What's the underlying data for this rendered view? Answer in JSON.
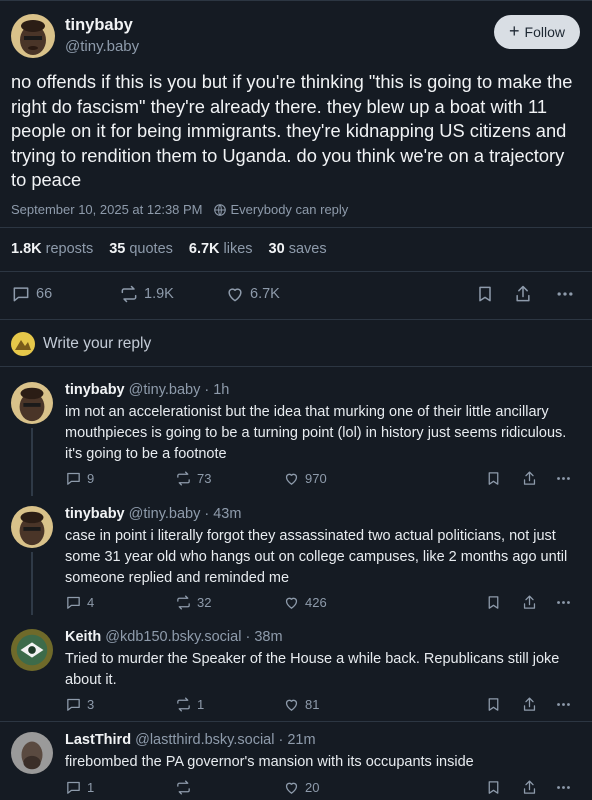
{
  "post": {
    "display_name": "tinybaby",
    "handle": "@tiny.baby",
    "follow_label": "Follow",
    "text": "no offends if this is you but if you're thinking \"this is going to make the right do fascism\" they're already there. they blew up a boat with 11 people on it for being immigrants. they're kidnapping US citizens and trying to rendition them to Uganda. do you think we're on a trajectory to peace",
    "timestamp": "September 10, 2025 at 12:38 PM",
    "reply_setting": "Everybody can reply",
    "stats": [
      {
        "count": "1.8K",
        "label": "reposts"
      },
      {
        "count": "35",
        "label": "quotes"
      },
      {
        "count": "6.7K",
        "label": "likes"
      },
      {
        "count": "30",
        "label": "saves"
      }
    ],
    "actions": {
      "replies": "66",
      "reposts": "1.9K",
      "likes": "6.7K"
    }
  },
  "reply_box": {
    "placeholder": "Write your reply"
  },
  "replies": [
    {
      "display_name": "tinybaby",
      "handle": "@tiny.baby",
      "time": "· 1h",
      "text": "im not an accelerationist but the idea that murking one of their little ancillary mouthpieces is going to be a turning point (lol) in history just seems ridiculous. it's going to be a footnote",
      "replies": "9",
      "reposts": "73",
      "likes": "970"
    },
    {
      "display_name": "tinybaby",
      "handle": "@tiny.baby",
      "time": "· 43m",
      "text": "case in point i literally forgot they assassinated two actual politicians, not just some 31 year old who hangs out on college campuses, like 2 months ago until someone replied and reminded me",
      "replies": "4",
      "reposts": "32",
      "likes": "426"
    },
    {
      "display_name": "Keith",
      "handle": "@kdb150.bsky.social",
      "time": "· 38m",
      "text": "Tried to murder the Speaker of the House a while back. Republicans still joke about it.",
      "replies": "3",
      "reposts": "1",
      "likes": "81"
    },
    {
      "display_name": "LastThird",
      "handle": "@lastthird.bsky.social",
      "time": "· 21m",
      "text": "firebombed the PA governor's mansion with its occupants inside",
      "replies": "1",
      "reposts": "",
      "likes": "20"
    }
  ],
  "icons": [
    "reply-icon",
    "repost-icon",
    "like-icon",
    "bookmark-icon",
    "share-icon",
    "more-icon",
    "globe-icon"
  ],
  "colors": {
    "background": "#151b23",
    "text": "#f1f3f5",
    "muted": "#8e9bab",
    "button": "#d9dee4"
  }
}
